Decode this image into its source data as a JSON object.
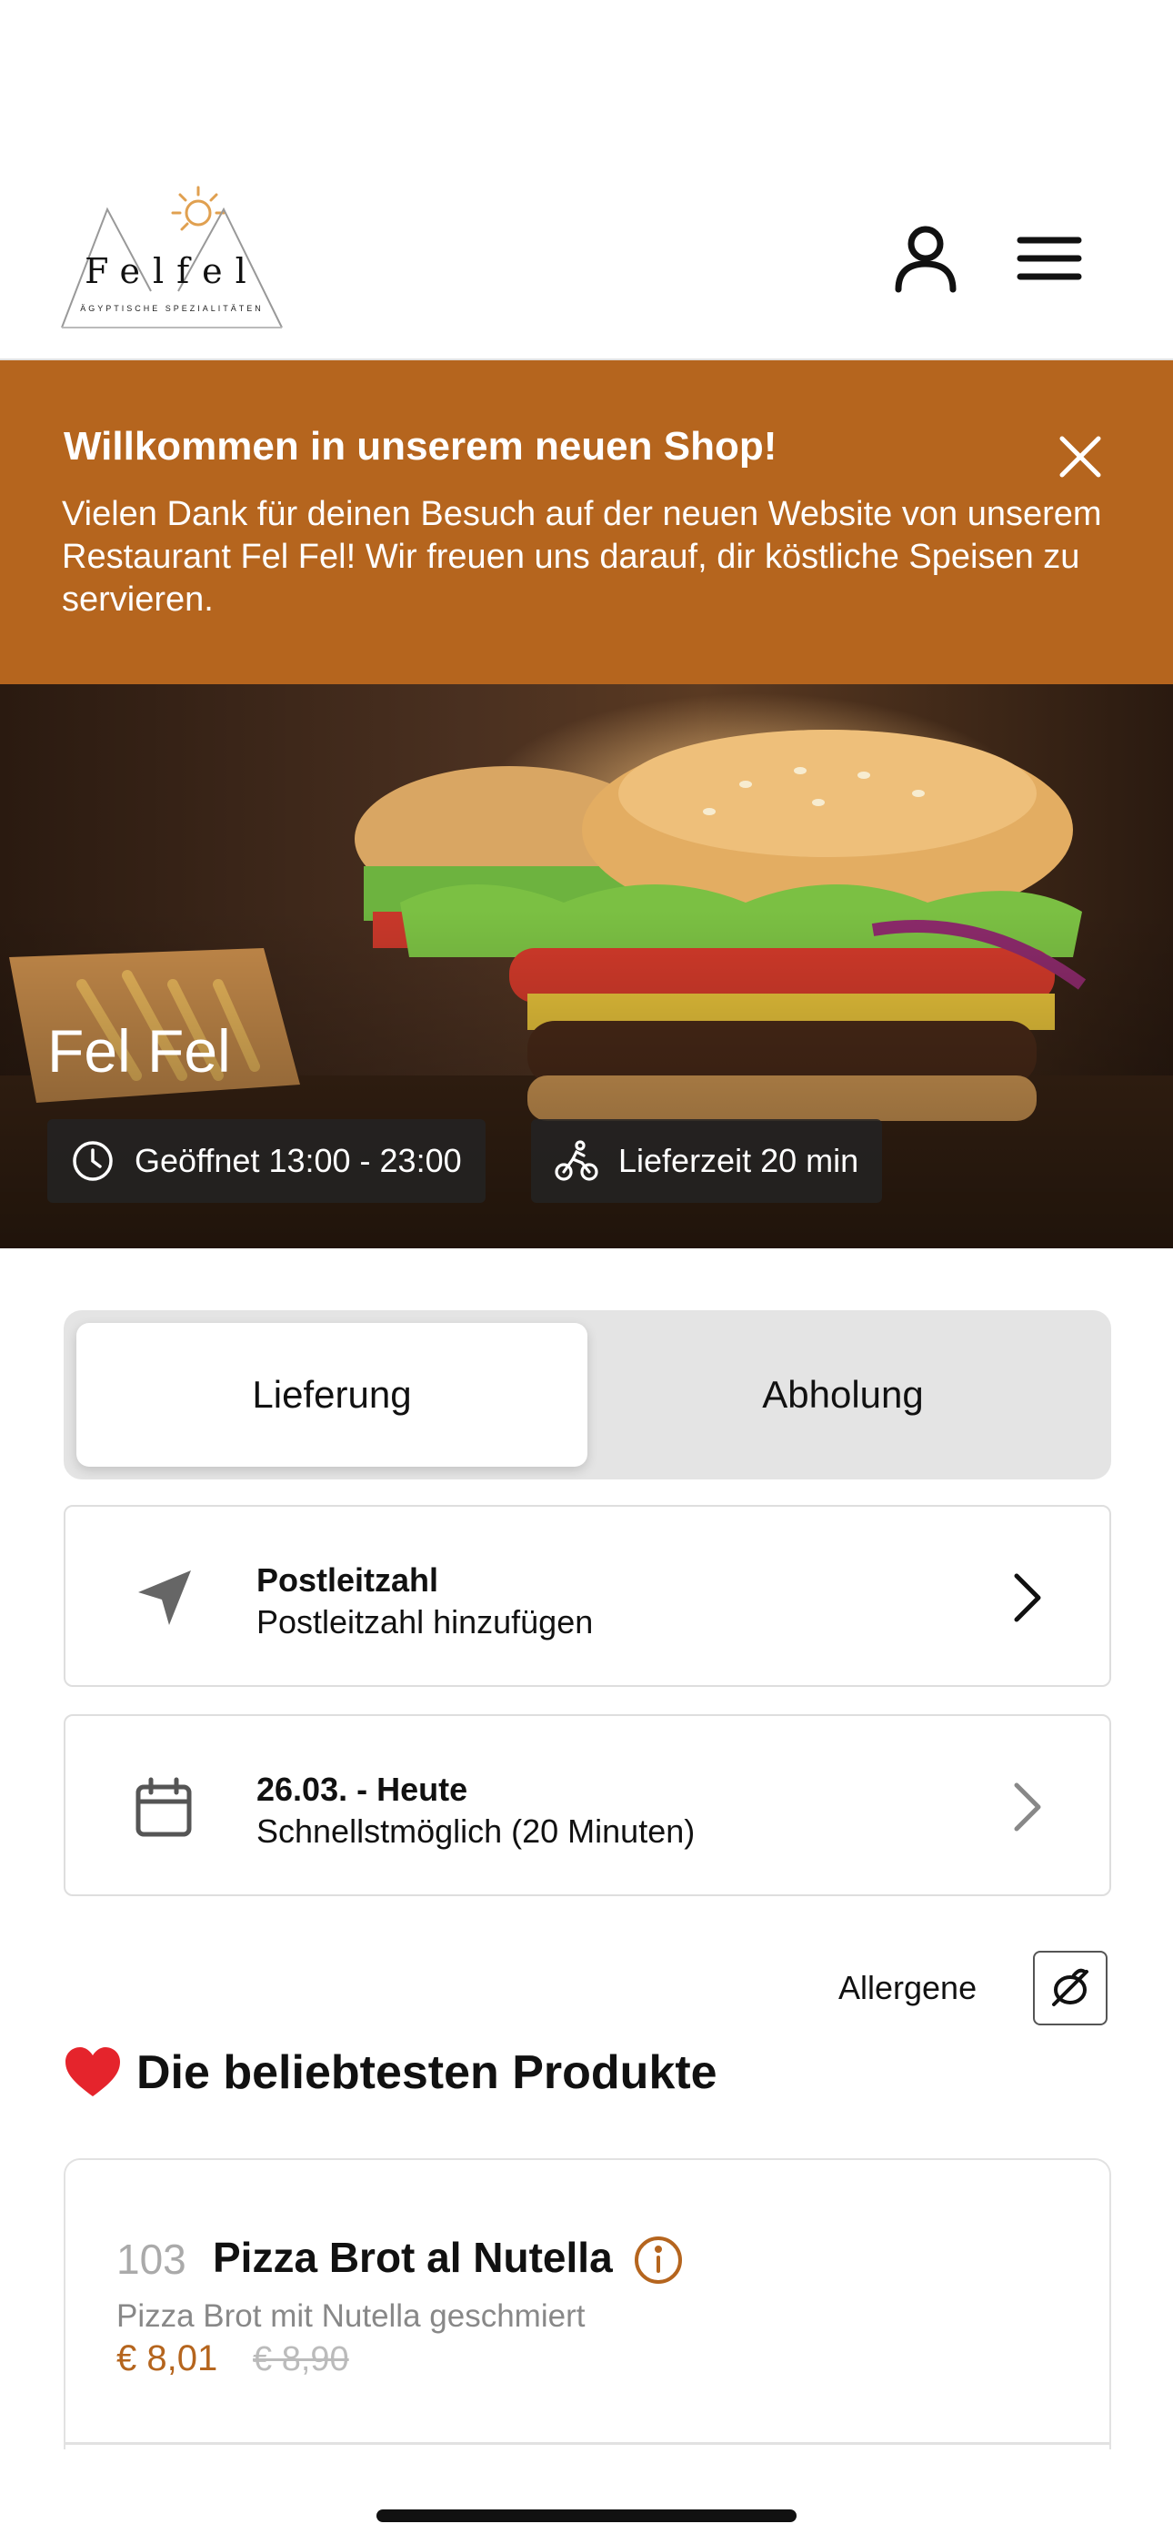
{
  "header": {
    "logo_text": "Felfel",
    "logo_subtitle": "ÄGYPTISCHE SPEZIALITÄTEN",
    "user_icon": "user-icon",
    "menu_icon": "hamburger-menu-icon"
  },
  "banner": {
    "title": "Willkommen in unserem neuen Shop!",
    "text": "Vielen Dank für deinen Besuch auf der neuen Website von unserem Restaurant Fel Fel! Wir freuen uns darauf, dir köstliche Speisen zu servieren.",
    "close_icon": "close-icon",
    "color": "#b5651e"
  },
  "hero": {
    "title": "Fel Fel",
    "opening": "Geöffnet 13:00 - 23:00",
    "delivery_time": "Lieferzeit 20 min"
  },
  "order_mode": {
    "options": [
      "Lieferung",
      "Abholung"
    ],
    "selected": "Lieferung"
  },
  "postcode": {
    "title": "Postleitzahl",
    "subtitle": "Postleitzahl hinzufügen"
  },
  "date": {
    "title": "26.03. - Heute",
    "subtitle": "Schnellstmöglich (20 Minuten)"
  },
  "allergens": {
    "label": "Allergene"
  },
  "popular": {
    "heading": "Die beliebtesten Produkte",
    "products": [
      {
        "number": "103",
        "name": "Pizza Brot al Nutella",
        "description": "Pizza Brot mit Nutella geschmiert",
        "price": "€ 8,01",
        "old_price": "€ 8,90"
      }
    ]
  }
}
